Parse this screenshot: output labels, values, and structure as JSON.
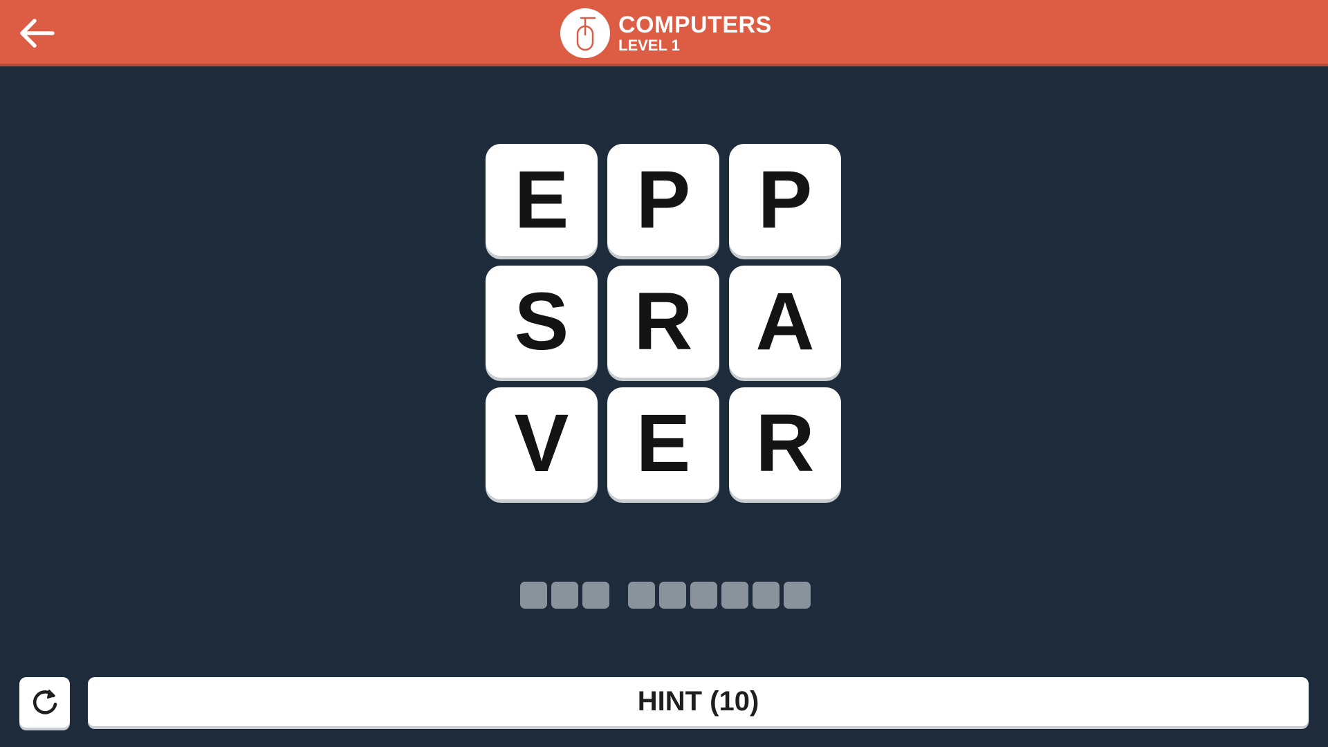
{
  "header": {
    "title": "COMPUTERS",
    "subtitle": "LEVEL 1",
    "back_icon": "arrow-left-icon",
    "category_icon": "computer-mouse-icon",
    "background_color": "#dc5d44"
  },
  "grid": {
    "tiles": [
      "E",
      "P",
      "P",
      "S",
      "R",
      "A",
      "V",
      "E",
      "R"
    ]
  },
  "answer": {
    "word_lengths": [
      3,
      6
    ],
    "filled": []
  },
  "footer": {
    "refresh_icon": "refresh-icon",
    "hint_label": "HINT (10)"
  },
  "colors": {
    "background": "#1e2b3a",
    "tile": "#ffffff",
    "slot": "#8a939c"
  }
}
